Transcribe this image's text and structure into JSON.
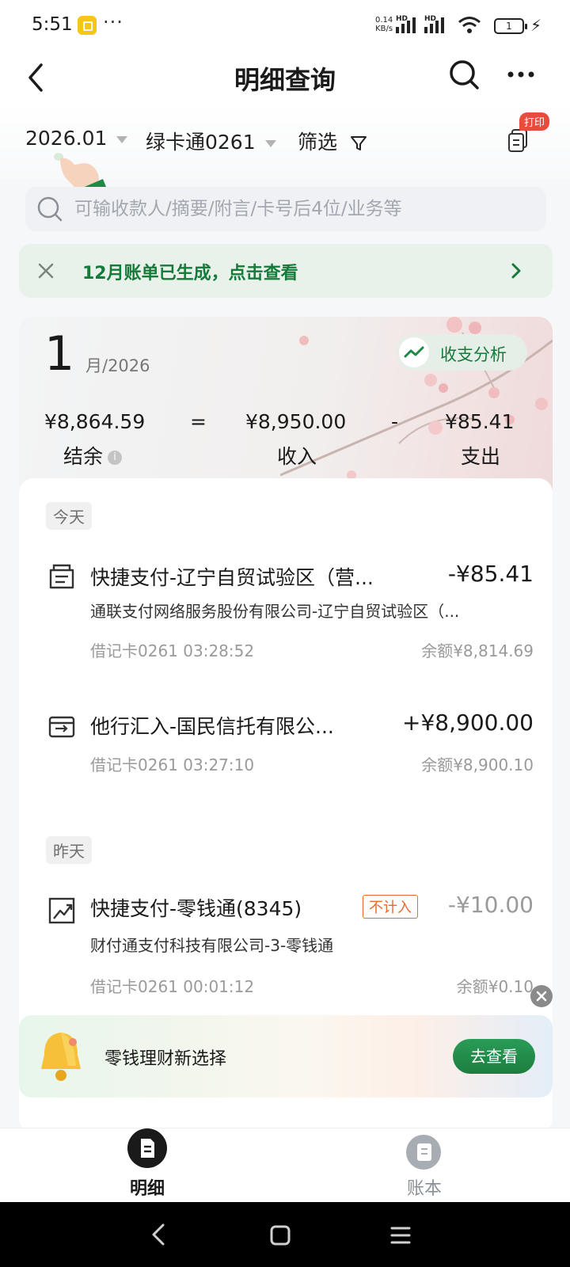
{
  "status_bar": {
    "time": "5:51",
    "more_indicator": "···",
    "net_speed_value": "0.14",
    "net_speed_unit": "KB/s",
    "signal_1_label": "HD",
    "signal_2_label": "HD",
    "battery": "1"
  },
  "header": {
    "title": "明细查询",
    "back_icon": "chevron-left-icon",
    "search_icon": "search-icon",
    "more_icon": "more-horizontal-icon"
  },
  "filters": {
    "month": "2026.01",
    "account": "绿卡通0261",
    "filter_label": "筛选",
    "print_badge": "打印"
  },
  "search": {
    "placeholder": "可输收款人/摘要/附言/卡号后4位/业务等",
    "value": ""
  },
  "notice_banner": {
    "text": "12月账单已生成，点击查看"
  },
  "summary": {
    "month": "1",
    "month_suffix": "月/2026",
    "analysis_label": "收支分析",
    "balance": "¥8,864.59",
    "balance_label": "结余",
    "equals": "=",
    "income": "¥8,950.00",
    "income_label": "收入",
    "minus": "-",
    "expense": "¥85.41",
    "expense_label": "支出"
  },
  "groups": [
    {
      "label": "今天",
      "transactions": [
        {
          "icon": "payment-icon",
          "title": "快捷支付-辽宁自贸试验区（营...",
          "amount": "-¥85.41",
          "subtitle": "通联支付网络服务股份有限公司-辽宁自贸试验区（...",
          "card_time": "借记卡0261 03:28:52",
          "balance": "余额¥8,814.69"
        },
        {
          "icon": "transfer-in-icon",
          "title": "他行汇入-国民信托有限公...",
          "amount": "+¥8,900.00",
          "subtitle": "",
          "card_time": "借记卡0261 03:27:10",
          "balance": "余额¥8,900.10"
        }
      ]
    },
    {
      "label": "昨天",
      "transactions": [
        {
          "icon": "trend-up-icon",
          "title": "快捷支付-零钱通(8345)",
          "tag": "不计入",
          "amount": "-¥10.00",
          "subtitle": "财付通支付科技有限公司-3-零钱通",
          "card_time": "借记卡0261 00:01:12",
          "balance": "余额¥0.10"
        }
      ]
    }
  ],
  "promo": {
    "text": "零钱理财新选择",
    "button": "去查看"
  },
  "bottom_nav": {
    "tabs": [
      {
        "label": "明细",
        "icon": "document-icon"
      },
      {
        "label": "账本",
        "icon": "ledger-icon"
      }
    ]
  },
  "colors": {
    "brand_green": "#157a3a",
    "expense_tag_orange": "#e76a2f",
    "muted_gray": "#9a9a9a"
  }
}
